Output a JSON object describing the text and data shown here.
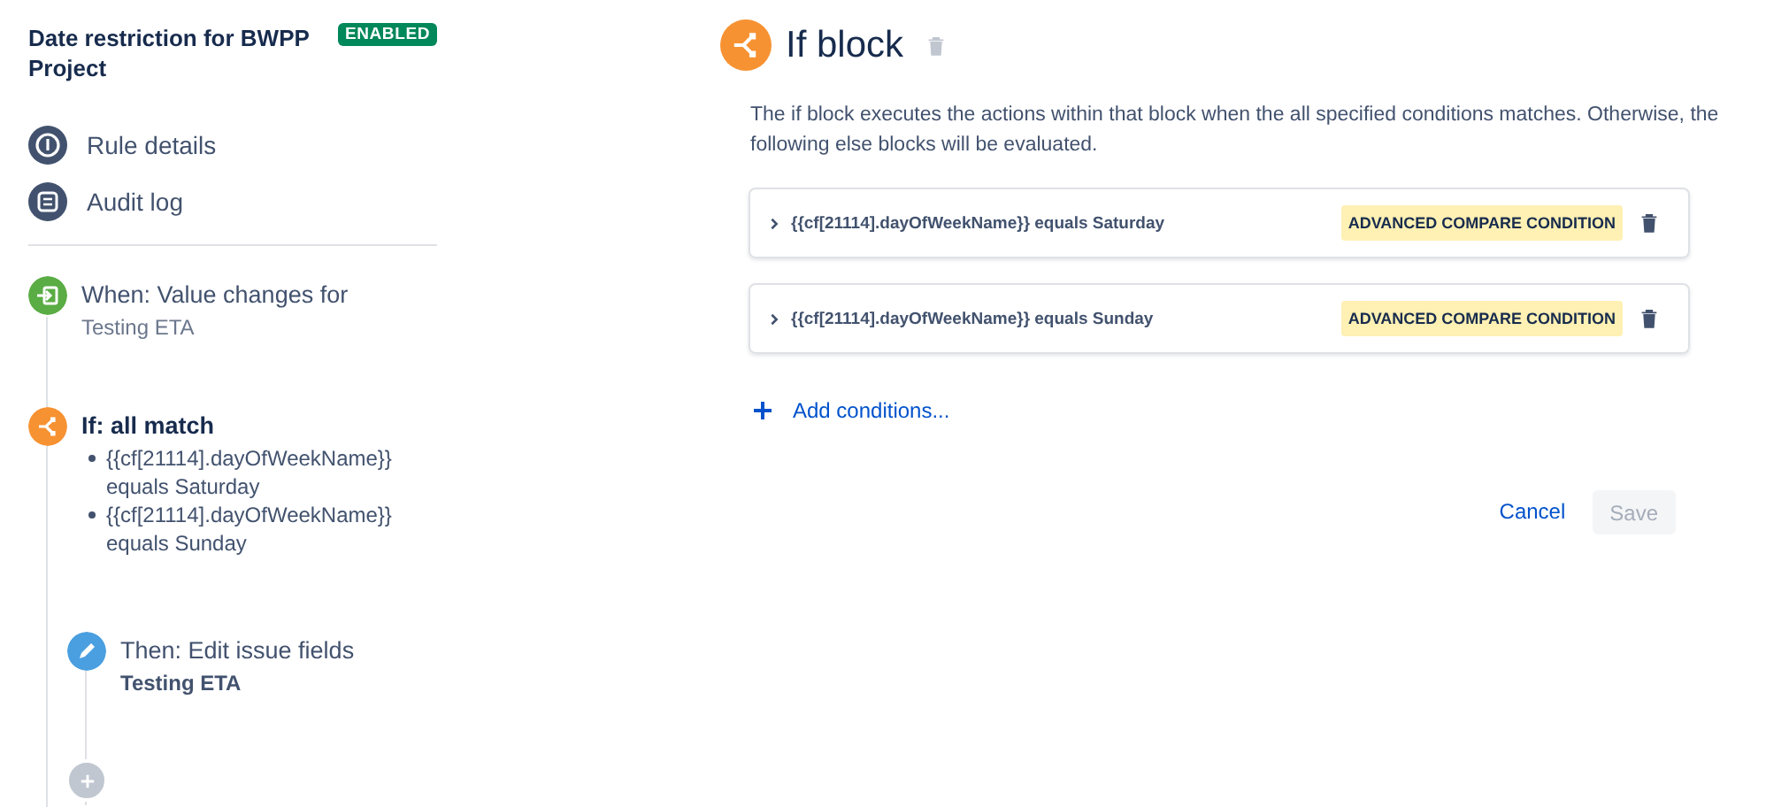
{
  "rule": {
    "title": "Date restriction for BWPP Project",
    "status": "ENABLED"
  },
  "nav": [
    {
      "label": "Rule details",
      "kind": "info"
    },
    {
      "label": "Audit log",
      "kind": "log"
    }
  ],
  "trigger": {
    "title": "When: Value changes for",
    "detail": "Testing ETA"
  },
  "condition": {
    "title": "If: all match",
    "items": [
      "{{cf[21114].dayOfWeekName}} equals Saturday",
      "{{cf[21114].dayOfWeekName}} equals Sunday"
    ]
  },
  "action": {
    "title": "Then: Edit issue fields",
    "detail": "Testing ETA"
  },
  "panel": {
    "title": "If block",
    "description": "The if block executes the actions within that block when the all specified conditions matches. Otherwise, the following else blocks will be evaluated.",
    "conditions": [
      {
        "text": "{{cf[21114].dayOfWeekName}} equals Saturday",
        "tag": "ADVANCED COMPARE CONDITION",
        "expanded": false
      },
      {
        "text": "{{cf[21114].dayOfWeekName}} equals Sunday",
        "tag": "ADVANCED COMPARE CONDITION",
        "expanded": false
      }
    ],
    "add_link": "Add conditions...",
    "cancel": "Cancel",
    "save": {
      "label": "Save",
      "disabled": true
    }
  }
}
